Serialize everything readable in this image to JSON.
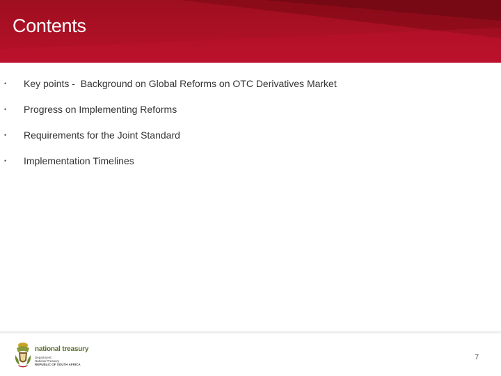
{
  "slide": {
    "title": "Contents",
    "bullets": [
      {
        "text": "Key points -  Background on Global Reforms on OTC Derivatives Market"
      },
      {
        "text": "Progress on Implementing Reforms"
      },
      {
        "text": "Requirements for the Joint Standard"
      },
      {
        "text": "Implementation Timelines"
      }
    ],
    "bullet_glyph": "•",
    "page_number": "7"
  },
  "footer": {
    "brand": "national treasury",
    "line1": "Department:",
    "line2": "National Treasury",
    "line3": "REPUBLIC OF SOUTH AFRICA"
  },
  "colors": {
    "header_red": "#b8102a",
    "header_dark": "#7a0a14",
    "brand_green": "#5a6e2e"
  }
}
